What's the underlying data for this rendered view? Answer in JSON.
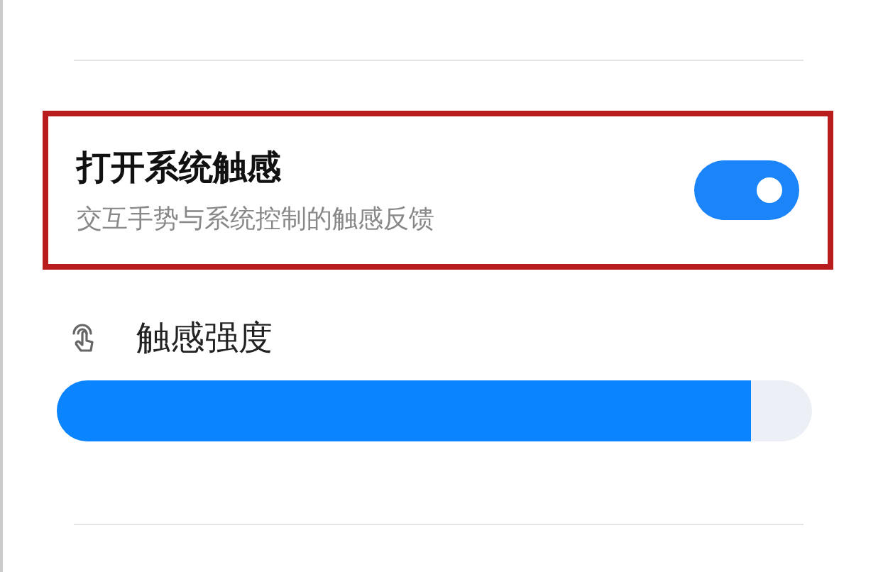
{
  "system_haptics": {
    "title": "打开系统触感",
    "subtitle": "交互手势与系统控制的触感反馈",
    "on": true,
    "highlighted": true
  },
  "haptic_strength": {
    "label": "触感强度",
    "level": 0.92
  }
}
